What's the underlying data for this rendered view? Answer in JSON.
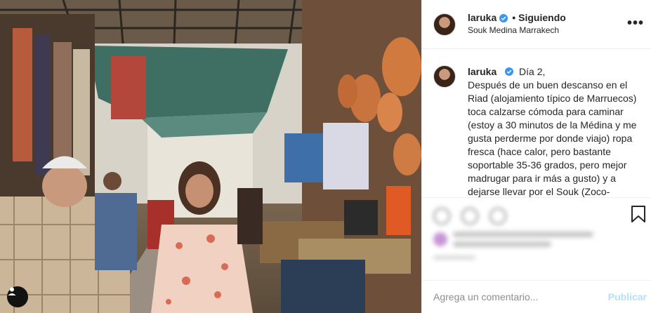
{
  "post": {
    "photo_alt": "",
    "username": "laruka",
    "follow_status": "Siguiendo",
    "separator": "•",
    "location": "Souk Medina Marrakech",
    "more_glyph": "•••"
  },
  "caption": {
    "username": "laruka",
    "text": "Día 2,\nDespués de un buen descanso en el Riad (alojamiento típico de Marruecos) toca calzarse cómoda para caminar (estoy a 30 minutos de la Médina y me gusta perderme por donde viajo) ropa fresca (hace calor, pero bastante soportable 35-36 grados, pero mejor madrugar para ir más a gusto) y a dejarse llevar por el Souk (Zoco-"
  },
  "comment_box": {
    "placeholder": "Agrega un comentario...",
    "publish_label": "Publicar"
  },
  "colors": {
    "verified": "#3897f0",
    "publish_disabled": "#b2dffc",
    "border": "#efefef"
  },
  "icons": [
    "verified-badge-icon",
    "more-options-icon",
    "heart-icon",
    "comment-icon",
    "share-icon",
    "bookmark-icon",
    "user-tag-icon"
  ]
}
